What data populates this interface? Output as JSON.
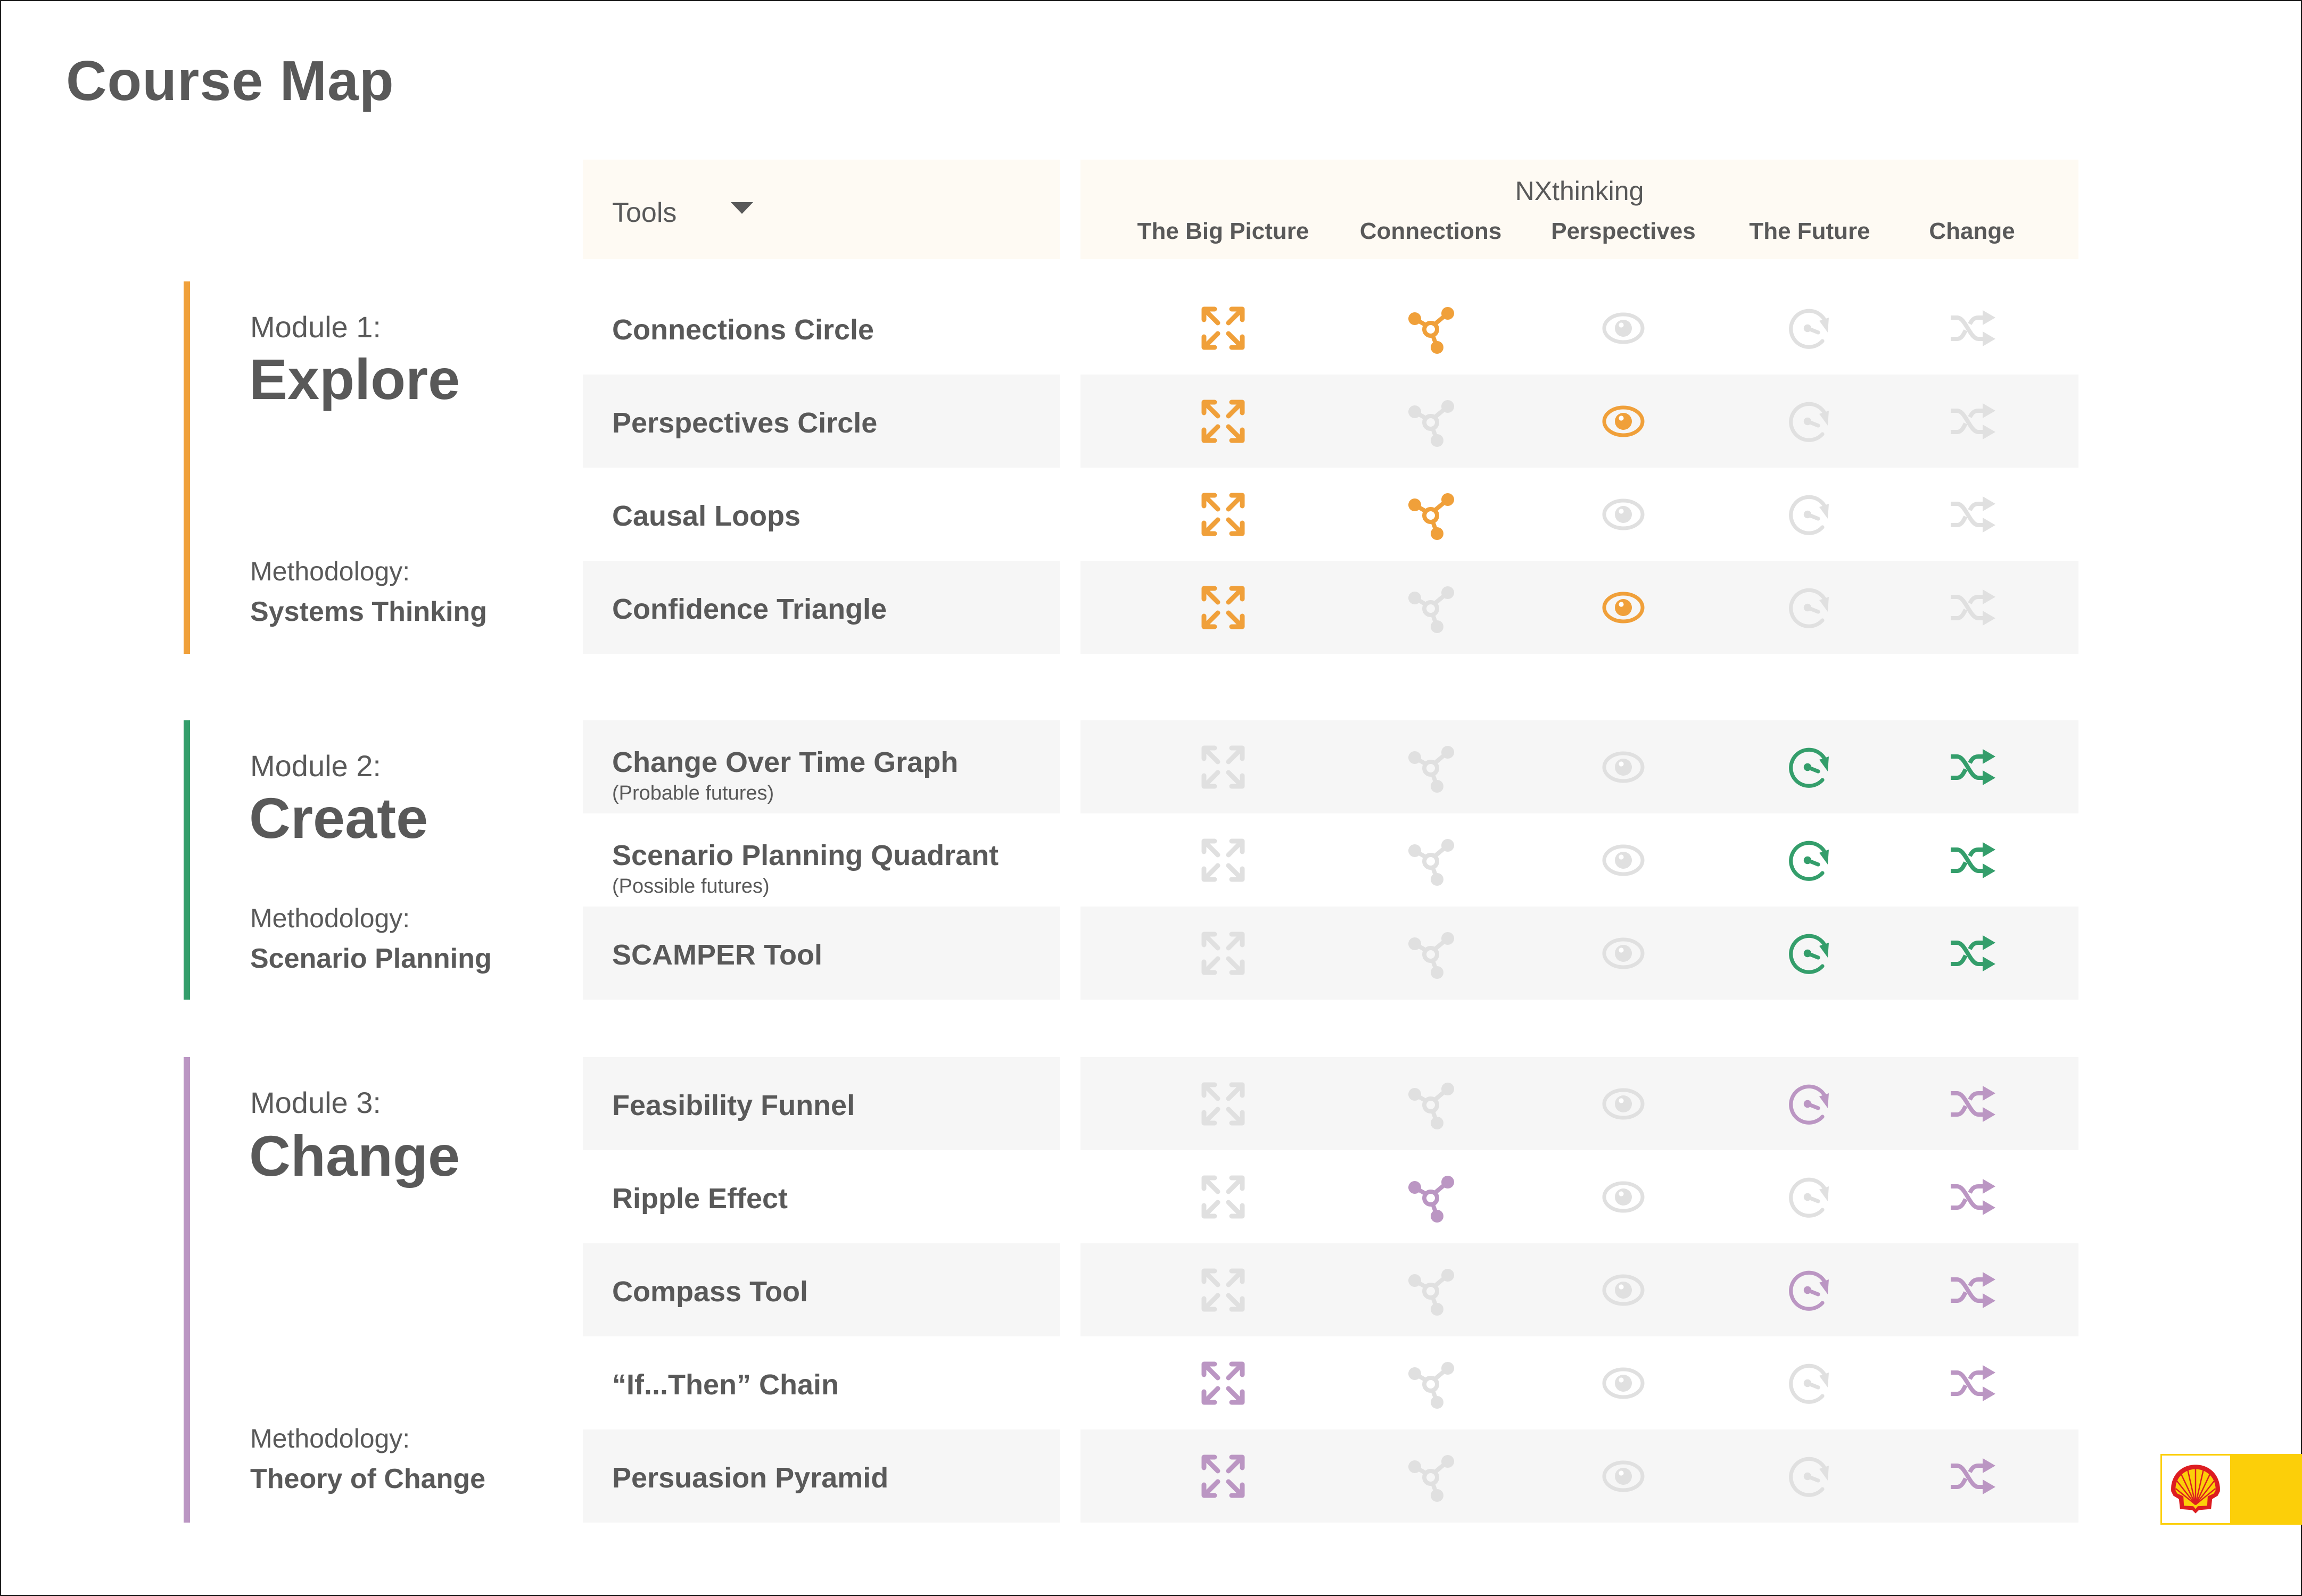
{
  "page": {
    "title": "Course Map"
  },
  "header": {
    "tools_label": "Tools",
    "group_label": "NXthinking",
    "columns": [
      "The Big Picture",
      "Connections",
      "Perspectives",
      "The Future",
      "Change"
    ]
  },
  "colors": {
    "orange": "#f0a03a",
    "green": "#349e6b",
    "purple": "#bb96c3",
    "inactive": "#e0e0e0",
    "text": "#595959",
    "header_bg": "#fefaf3",
    "row_shade": "#f6f6f6",
    "shell_yellow": "#fccf09",
    "shell_red": "#dd1d21"
  },
  "modules": [
    {
      "number_label": "Module 1:",
      "name": "Explore",
      "methodology_label": "Methodology:",
      "methodology": "Systems Thinking",
      "color": "orange",
      "tools": [
        {
          "name": "Connections Circle",
          "subtitle": "",
          "active": [
            true,
            true,
            false,
            false,
            false
          ]
        },
        {
          "name": "Perspectives Circle",
          "subtitle": "",
          "active": [
            true,
            false,
            true,
            false,
            false
          ]
        },
        {
          "name": "Causal Loops",
          "subtitle": "",
          "active": [
            true,
            true,
            false,
            false,
            false
          ]
        },
        {
          "name": "Confidence Triangle",
          "subtitle": "",
          "active": [
            true,
            false,
            true,
            false,
            false
          ]
        }
      ]
    },
    {
      "number_label": "Module 2:",
      "name": "Create",
      "methodology_label": "Methodology:",
      "methodology": "Scenario Planning",
      "color": "green",
      "tools": [
        {
          "name": "Change Over Time Graph",
          "subtitle": "(Probable futures)",
          "active": [
            false,
            false,
            false,
            true,
            true
          ]
        },
        {
          "name": "Scenario Planning Quadrant",
          "subtitle": "(Possible futures)",
          "active": [
            false,
            false,
            false,
            true,
            true
          ]
        },
        {
          "name": "SCAMPER Tool",
          "subtitle": "",
          "active": [
            false,
            false,
            false,
            true,
            true
          ]
        }
      ]
    },
    {
      "number_label": "Module 3:",
      "name": "Change",
      "methodology_label": "Methodology:",
      "methodology": "Theory of Change",
      "color": "purple",
      "tools": [
        {
          "name": "Feasibility Funnel",
          "subtitle": "",
          "active": [
            false,
            false,
            false,
            true,
            true
          ]
        },
        {
          "name": "Ripple Effect",
          "subtitle": "",
          "active": [
            false,
            true,
            false,
            false,
            true
          ]
        },
        {
          "name": "Compass Tool",
          "subtitle": "",
          "active": [
            false,
            false,
            false,
            true,
            true
          ]
        },
        {
          "name": "“If...Then” Chain",
          "subtitle": "",
          "active": [
            true,
            false,
            false,
            false,
            true
          ]
        },
        {
          "name": "Persuasion Pyramid",
          "subtitle": "",
          "active": [
            true,
            false,
            false,
            false,
            true
          ]
        }
      ]
    }
  ],
  "icons": [
    "expand-arrows-icon",
    "network-nodes-icon",
    "eye-icon",
    "clock-rotate-icon",
    "shuffle-icon"
  ],
  "logo": {
    "name": "shell-logo"
  }
}
